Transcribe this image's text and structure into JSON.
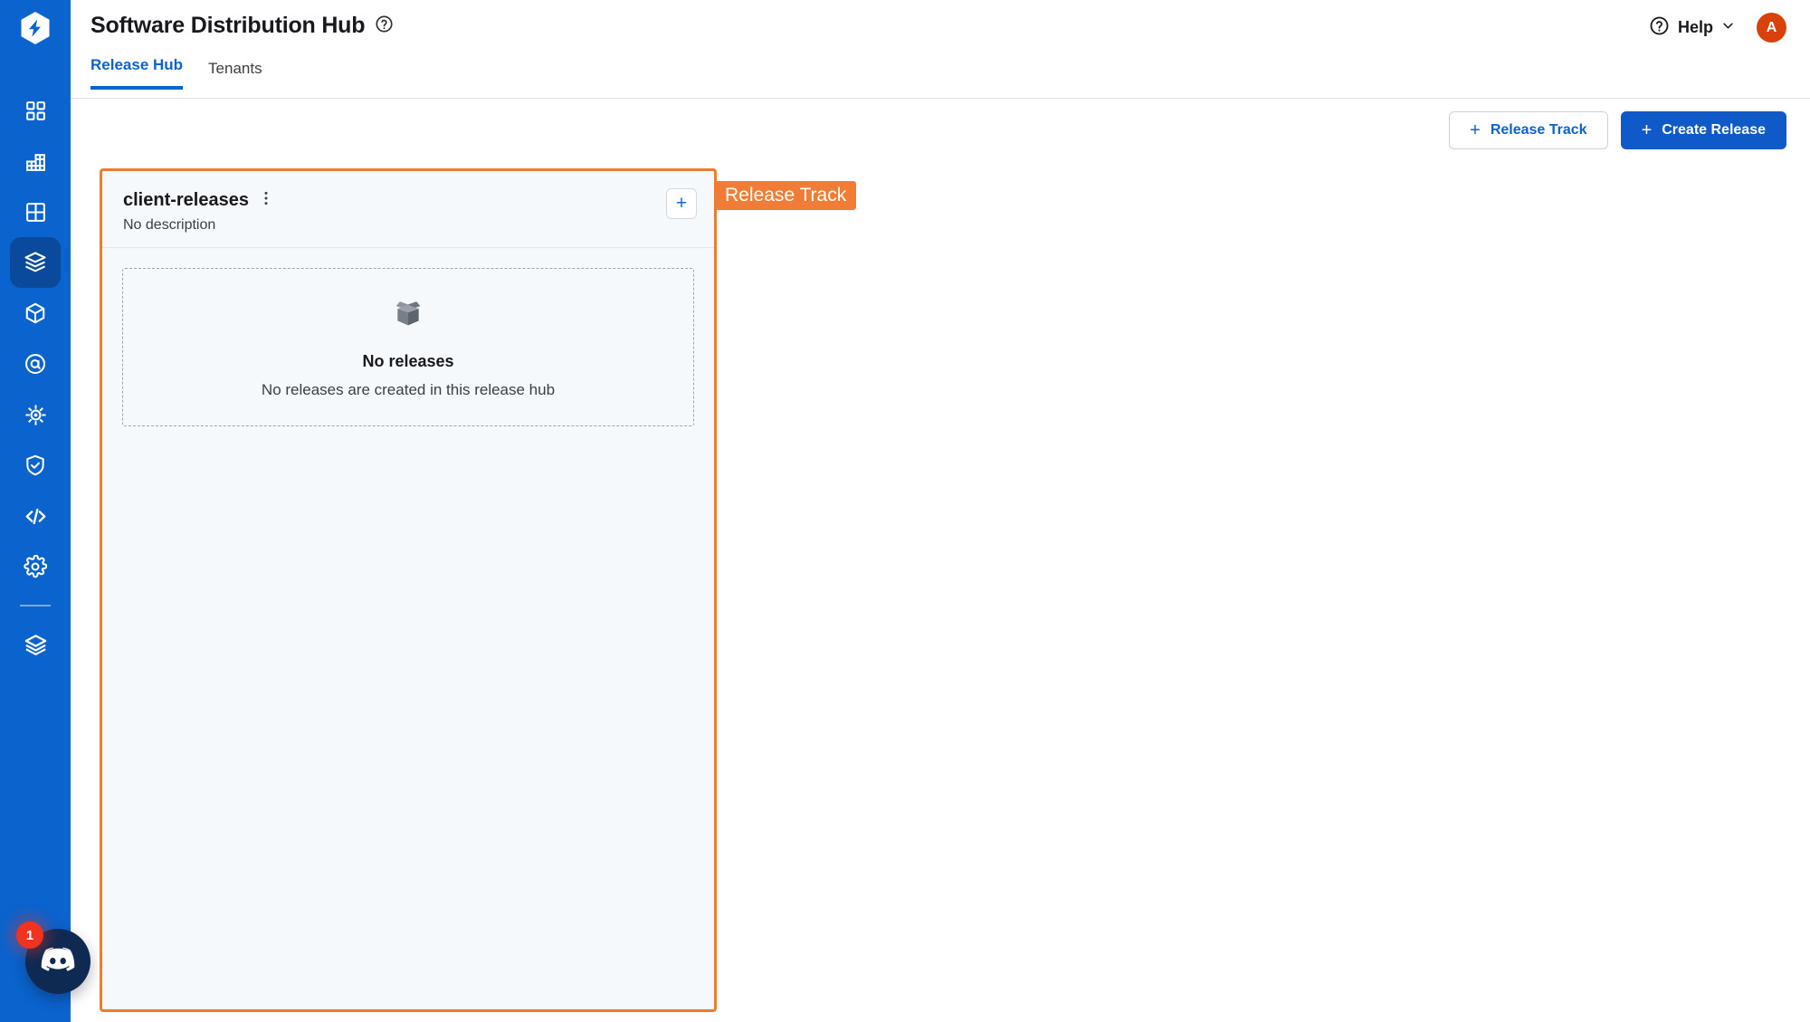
{
  "colors": {
    "rail_blue": "#0B63CE",
    "rail_active": "#0A4A9C",
    "primary_button": "#1059C9",
    "link_blue": "#0B63CE",
    "annotation_orange": "#F07C35",
    "card_border_orange": "#EE7B2E",
    "avatar_orange": "#D9410B",
    "badge_red": "#F0331E",
    "card_background": "#F6F9FC"
  },
  "rail": {
    "logo_icon": "hexagon-bolt-logo-icon",
    "items": [
      {
        "icon": "dashboard-grid-icon",
        "name": "sidebar-item-dashboard",
        "active": false
      },
      {
        "icon": "bar-chart-grid-icon",
        "name": "sidebar-item-analytics",
        "active": false
      },
      {
        "icon": "table-grid-icon",
        "name": "sidebar-item-workspaces",
        "active": false
      },
      {
        "icon": "open-box-icon",
        "name": "sidebar-item-software-distribution",
        "active": true
      },
      {
        "icon": "cube-icon",
        "name": "sidebar-item-artifacts",
        "active": false
      },
      {
        "icon": "target-at-icon",
        "name": "sidebar-item-registry",
        "active": false
      },
      {
        "icon": "helm-wheel-icon",
        "name": "sidebar-item-kubernetes",
        "active": false
      },
      {
        "icon": "shield-check-icon",
        "name": "sidebar-item-security",
        "active": false
      },
      {
        "icon": "code-brackets-icon",
        "name": "sidebar-item-code",
        "active": false
      },
      {
        "icon": "gear-icon",
        "name": "sidebar-item-settings",
        "active": false
      },
      {
        "icon": "layers-stack-icon",
        "name": "sidebar-item-layers",
        "active": false
      }
    ],
    "chat": {
      "icon": "discord-chat-icon",
      "badge_count": "1"
    }
  },
  "header": {
    "title": "Software Distribution Hub",
    "title_help_icon": "question-circle-icon",
    "help": {
      "icon": "question-circle-icon",
      "label": "Help",
      "chevron_icon": "chevron-down-icon"
    },
    "avatar": {
      "initial": "A"
    },
    "tabs": [
      {
        "label": "Release Hub",
        "active": true
      },
      {
        "label": "Tenants",
        "active": false
      }
    ]
  },
  "action_bar": {
    "release_track_button": {
      "label": "Release Track",
      "plus": "+"
    },
    "create_release_button": {
      "label": "Create Release",
      "plus": "+"
    }
  },
  "track_card": {
    "title": "client-releases",
    "menu_icon": "kebab-menu-icon",
    "description": "No description",
    "add_button": {
      "icon": "plus-icon",
      "glyph": "+"
    },
    "empty_state": {
      "icon": "open-box-icon",
      "title": "No releases",
      "subtitle": "No releases are created in this release hub"
    }
  },
  "annotation": {
    "label": "Release Track"
  }
}
